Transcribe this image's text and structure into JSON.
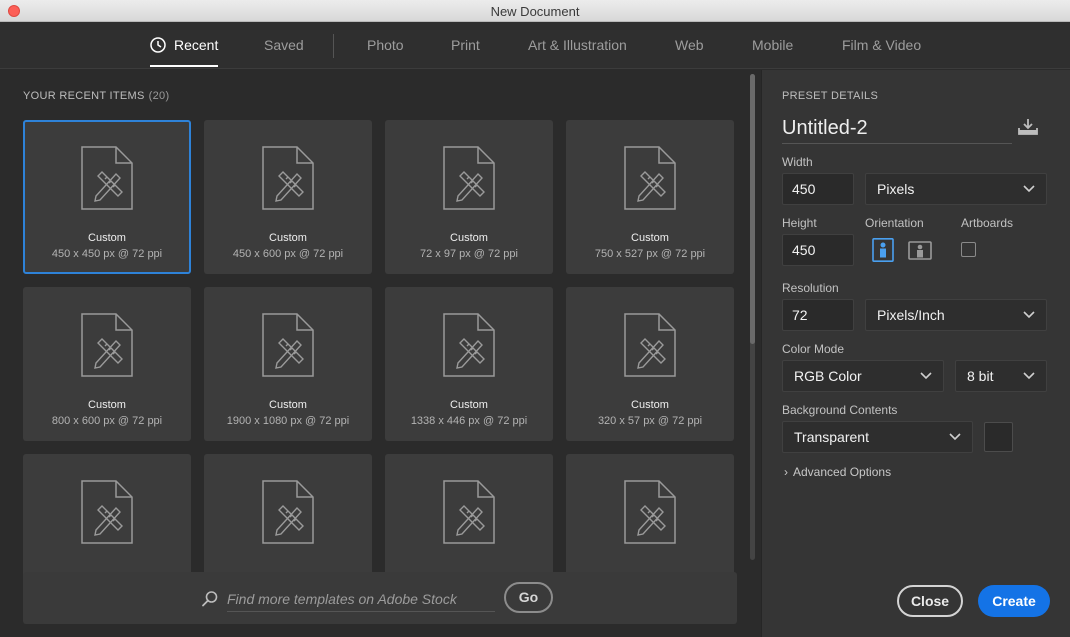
{
  "window": {
    "title": "New Document"
  },
  "nav": {
    "tabs": [
      {
        "label": "Recent",
        "active": true
      },
      {
        "label": "Saved"
      },
      {
        "label": "Photo"
      },
      {
        "label": "Print"
      },
      {
        "label": "Art & Illustration"
      },
      {
        "label": "Web"
      },
      {
        "label": "Mobile"
      },
      {
        "label": "Film & Video"
      }
    ]
  },
  "recent": {
    "title": "YOUR RECENT ITEMS",
    "count": "(20)",
    "items": [
      {
        "name": "Custom",
        "desc": "450 x 450 px @ 72 ppi",
        "selected": true
      },
      {
        "name": "Custom",
        "desc": "450 x 600 px @ 72 ppi"
      },
      {
        "name": "Custom",
        "desc": "72 x 97 px @ 72 ppi"
      },
      {
        "name": "Custom",
        "desc": "750 x 527 px @ 72 ppi"
      },
      {
        "name": "Custom",
        "desc": "800 x 600 px @ 72 ppi"
      },
      {
        "name": "Custom",
        "desc": "1900 x 1080 px @ 72 ppi"
      },
      {
        "name": "Custom",
        "desc": "1338 x 446 px @ 72 ppi"
      },
      {
        "name": "Custom",
        "desc": "320 x 57 px @ 72 ppi"
      },
      {
        "name": "",
        "desc": ""
      },
      {
        "name": "",
        "desc": ""
      },
      {
        "name": "",
        "desc": ""
      },
      {
        "name": "",
        "desc": ""
      }
    ]
  },
  "search": {
    "placeholder": "Find more templates on Adobe Stock",
    "go_label": "Go"
  },
  "preset": {
    "heading": "PRESET DETAILS",
    "name": "Untitled-2",
    "width_label": "Width",
    "width_value": "450",
    "width_unit": "Pixels",
    "height_label": "Height",
    "height_value": "450",
    "orientation_label": "Orientation",
    "orientation_selected": "portrait",
    "artboards_label": "Artboards",
    "artboards_checked": false,
    "resolution_label": "Resolution",
    "resolution_value": "72",
    "resolution_unit": "Pixels/Inch",
    "color_mode_label": "Color Mode",
    "color_mode": "RGB Color",
    "bit_depth": "8 bit",
    "background_label": "Background Contents",
    "background_value": "Transparent",
    "advanced_label": "Advanced Options"
  },
  "actions": {
    "close_label": "Close",
    "create_label": "Create"
  },
  "colors": {
    "accent_blue": "#1473e6",
    "selected_border": "#2e82d8",
    "panel_bg": "#2b2b2b",
    "card_bg": "#3c3c3c",
    "right_panel_bg": "#353535"
  }
}
